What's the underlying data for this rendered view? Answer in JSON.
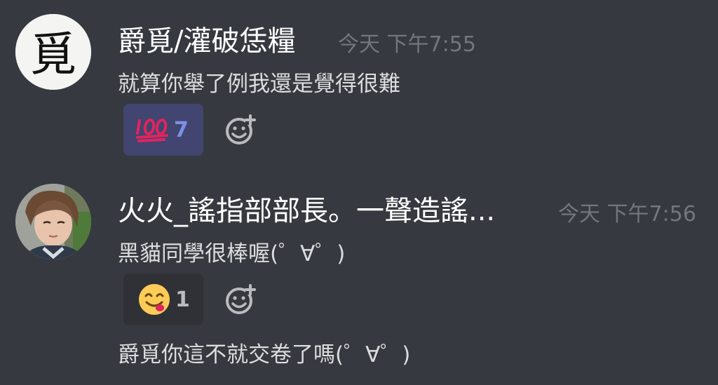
{
  "messages": [
    {
      "username": "爵覓/灌破恁糧",
      "timestamp": "今天 下午7:55",
      "text": "就算你舉了例我還是覺得很難",
      "avatar_glyph": "覓",
      "reaction": {
        "emoji_icon": "hundred-points-emoji",
        "emoji": "💯",
        "count": "7",
        "reacted_by_me": true
      }
    },
    {
      "username": "火火_謠指部部長。一聲造謠...",
      "timestamp": "今天 下午7:56",
      "text": "黑貓同學很棒喔(゜∀゜)",
      "reaction": {
        "emoji_icon": "yum-face-emoji",
        "emoji": "😋",
        "count": "1",
        "reacted_by_me": false
      }
    }
  ],
  "followup_text": "爵覓你這不就交卷了嗎(゜∀゜)",
  "colors": {
    "background": "#36393f",
    "username": "#ffffff",
    "timestamp": "#72767d",
    "text": "#dcddde",
    "reaction_me_bg": "#41456f",
    "reaction_me_count": "#7d8fe6",
    "reaction_other_bg": "#2f3136"
  }
}
